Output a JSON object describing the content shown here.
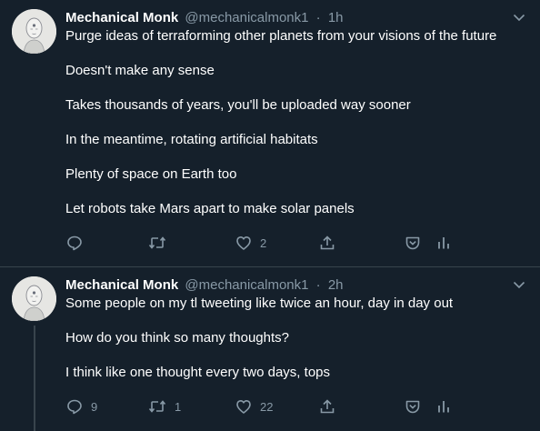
{
  "tweets": [
    {
      "author": {
        "name": "Mechanical Monk",
        "handle": "@mechanicalmonk1"
      },
      "separator": "·",
      "time": "1h",
      "lines": [
        "Purge ideas of terraforming other planets from your visions of the future",
        "Doesn't make any sense",
        "Takes thousands of years, you'll be uploaded way sooner",
        "In the meantime, rotating artificial habitats",
        "Plenty of space on Earth too",
        "Let robots take Mars apart to make solar panels"
      ],
      "actions": {
        "reply_count": "",
        "retweet_count": "",
        "like_count": "2"
      }
    },
    {
      "author": {
        "name": "Mechanical Monk",
        "handle": "@mechanicalmonk1"
      },
      "separator": "·",
      "time": "2h",
      "lines": [
        "Some people on my tl tweeting like twice an hour, day in day out",
        "How do you think so many thoughts?",
        "I think like one thought every two days, tops"
      ],
      "actions": {
        "reply_count": "9",
        "retweet_count": "1",
        "like_count": "22"
      }
    }
  ],
  "icons": {
    "reply": "speech-bubble",
    "retweet": "two-arrows-loop",
    "like": "heart",
    "share": "upload-arrow",
    "bookmark": "pocket",
    "analytics": "bar-chart",
    "menu": "chevron-down"
  },
  "colors": {
    "background": "#15202b",
    "text": "#ffffff",
    "muted": "#8899a6",
    "divider": "#38444d"
  }
}
